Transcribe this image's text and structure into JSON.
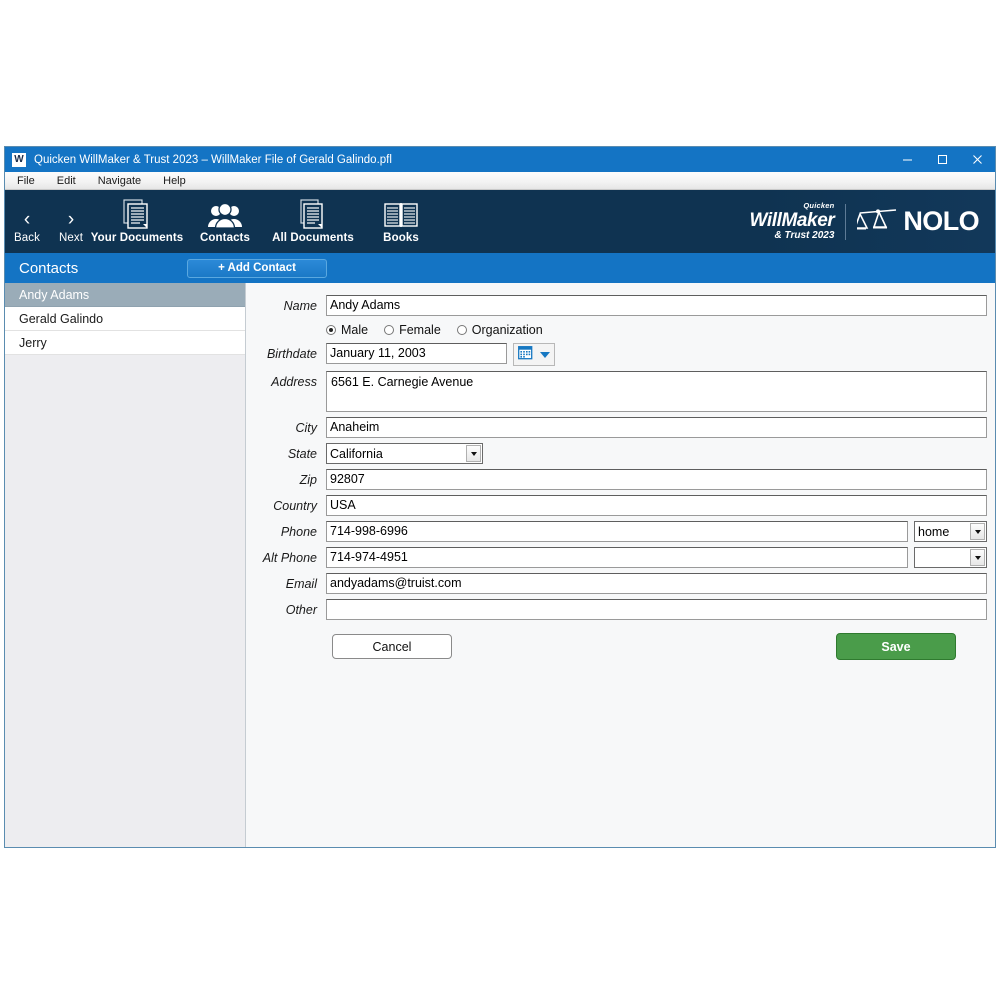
{
  "window": {
    "logo_letter": "W",
    "title": "Quicken WillMaker & Trust 2023 – WillMaker File of Gerald Galindo.pfl",
    "minimize_label": "minimize",
    "maximize_label": "maximize",
    "close_label": "close",
    "titlebar_color": "#1474c4"
  },
  "menubar": {
    "items": [
      {
        "label": "File"
      },
      {
        "label": "Edit"
      },
      {
        "label": "Navigate"
      },
      {
        "label": "Help"
      }
    ]
  },
  "toolbar": {
    "background": "#0f3351",
    "items": [
      {
        "label": "Back",
        "icon": "chevron-left-icon",
        "glyph": "‹"
      },
      {
        "label": "Next",
        "icon": "chevron-right-icon",
        "glyph": "›"
      },
      {
        "label": "Your Documents",
        "icon": "documents-icon"
      },
      {
        "label": "Contacts",
        "icon": "people-icon"
      },
      {
        "label": "All Documents",
        "icon": "all-documents-icon"
      },
      {
        "label": "Books",
        "icon": "books-icon"
      }
    ],
    "branding": {
      "quicken": "Quicken",
      "willmaker": "WillMaker",
      "trust": "& Trust 2023",
      "nolo": "NOLO",
      "nolo_icon": "scales-of-justice-icon"
    }
  },
  "page_header": {
    "title": "Contacts",
    "add_button": "+ Add Contact",
    "background": "#1474c4"
  },
  "sidebar": {
    "contacts": [
      {
        "name": "Andy Adams",
        "selected": true
      },
      {
        "name": "Gerald Galindo",
        "selected": false
      },
      {
        "name": "Jerry",
        "selected": false
      }
    ],
    "selected_background": "#9aacb8"
  },
  "form": {
    "labels": {
      "name": "Name",
      "birthdate": "Birthdate",
      "address": "Address",
      "city": "City",
      "state": "State",
      "zip": "Zip",
      "country": "Country",
      "phone": "Phone",
      "alt_phone": "Alt Phone",
      "email": "Email",
      "other": "Other"
    },
    "values": {
      "name": "Andy Adams",
      "birthdate": "January 11, 2003",
      "address": "6561 E. Carnegie Avenue",
      "city": "Anaheim",
      "state": "California",
      "zip": "92807",
      "country": "USA",
      "phone": "714-998-6996",
      "phone_type": "home",
      "alt_phone": "714-974-4951",
      "alt_phone_type": "",
      "email": "andyadams@truist.com",
      "other": ""
    },
    "gender_options": [
      {
        "label": "Male",
        "selected": true
      },
      {
        "label": "Female",
        "selected": false
      },
      {
        "label": "Organization",
        "selected": false
      }
    ],
    "calendar_icon": "calendar-icon",
    "buttons": {
      "cancel": "Cancel",
      "save": "Save",
      "save_color": "#4a9c4a"
    }
  }
}
